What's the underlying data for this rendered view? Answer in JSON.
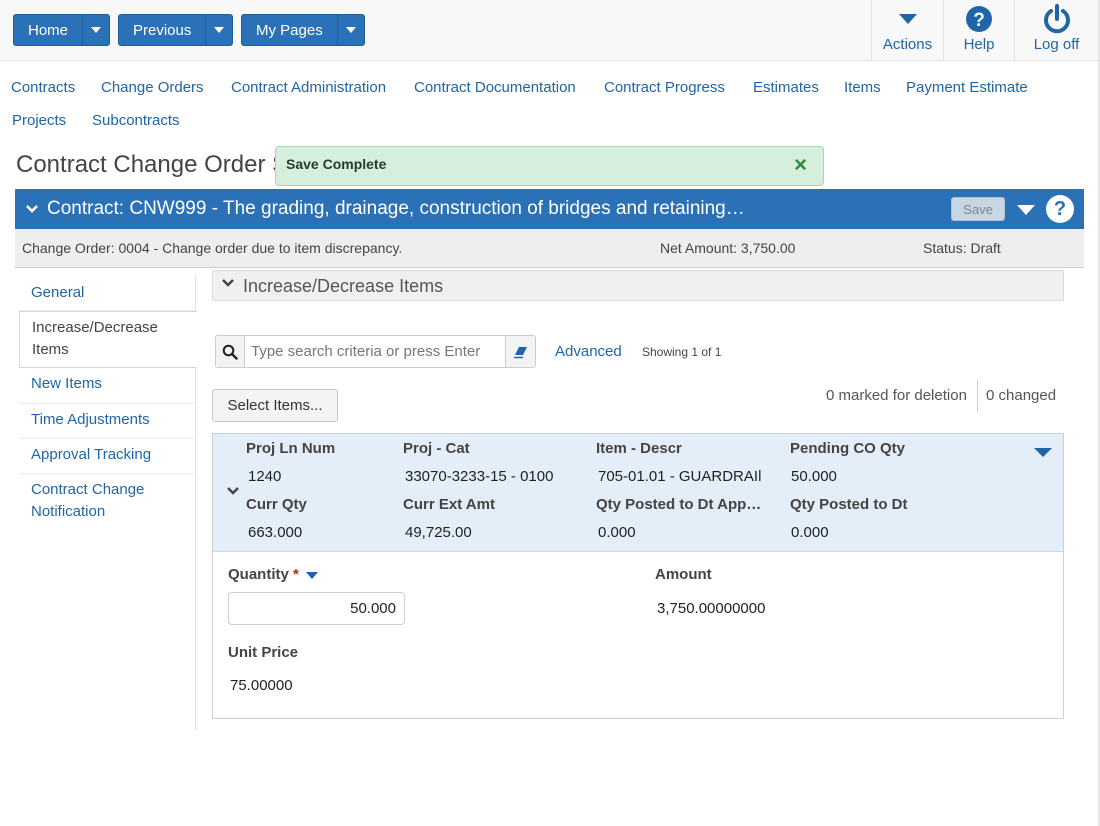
{
  "topnav": {
    "home": "Home",
    "previous": "Previous",
    "my_pages": "My Pages",
    "actions": "Actions",
    "help": "Help",
    "logoff": "Log off"
  },
  "menu": {
    "row1": [
      "Contracts",
      "Change Orders",
      "Contract Administration",
      "Contract Documentation",
      "Contract Progress",
      "Estimates",
      "Items",
      "Payment Estimate"
    ],
    "row2": [
      "Projects",
      "Subcontracts"
    ]
  },
  "page_title": "Contract Change Order S",
  "toast": {
    "message": "Save Complete",
    "close": "×"
  },
  "contract": {
    "title": "Contract: CNW999 - The grading, drainage, construction of bridges and retaining…",
    "save_label": "Save",
    "help": "?"
  },
  "change_order": {
    "label": "Change Order: 0004 - Change order due to item discrepancy.",
    "net_amount": "Net Amount: 3,750.00",
    "status": "Status: Draft"
  },
  "sidebar": {
    "items": [
      {
        "label": "General"
      },
      {
        "label": "Increase/Decrease Items"
      },
      {
        "label": "New Items"
      },
      {
        "label": "Time Adjustments"
      },
      {
        "label": "Approval Tracking"
      },
      {
        "label": "Contract Change Notification"
      }
    ]
  },
  "section": {
    "title": "Increase/Decrease Items"
  },
  "search": {
    "placeholder": "Type search criteria or press Enter",
    "advanced": "Advanced",
    "showing": "Showing 1 of 1"
  },
  "toolbar": {
    "select_items": "Select Items...",
    "marked_for_deletion": "0 marked for deletion",
    "changed": "0 changed"
  },
  "item": {
    "labels": {
      "proj_ln_num": "Proj Ln Num",
      "proj_cat": "Proj - Cat",
      "item_descr": "Item - Descr",
      "pending_co_qty": "Pending CO Qty",
      "curr_qty": "Curr Qty",
      "curr_ext_amt": "Curr Ext Amt",
      "qty_posted_app": "Qty Posted to Dt App…",
      "qty_posted": "Qty Posted to Dt"
    },
    "values": {
      "proj_ln_num": "1240",
      "proj_cat": "33070-3233-15 - 0100",
      "item_descr": "705-01.01 - GUARDRAIl",
      "pending_co_qty": "50.000",
      "curr_qty": "663.000",
      "curr_ext_amt": "49,725.00",
      "qty_posted_app": "0.000",
      "qty_posted": "0.000"
    },
    "detail": {
      "quantity_label": "Quantity",
      "required_mark": "*",
      "quantity_value": "50.000",
      "amount_label": "Amount",
      "amount_value": "3,750.00000000",
      "unit_price_label": "Unit Price",
      "unit_price_value": "75.00000"
    }
  }
}
